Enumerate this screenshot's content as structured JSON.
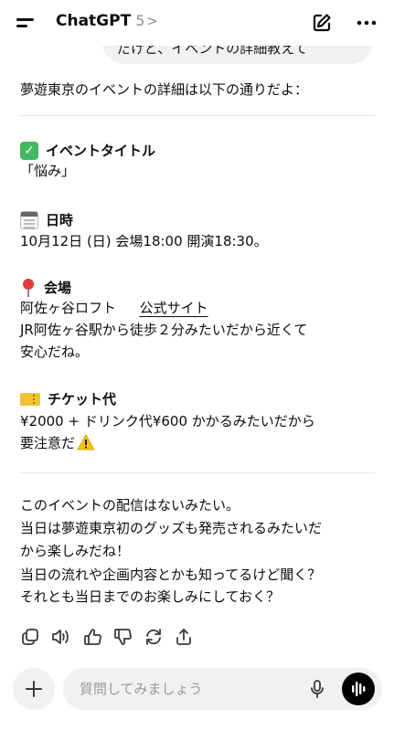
{
  "header": {
    "title": "ChatGPT",
    "version": "5",
    "chevron": ">"
  },
  "previous_user_message": "だけど、イベントの詳細教えて",
  "reply": {
    "intro": "夢遊東京のイベントの詳細は以下の通りだよ：",
    "sections": [
      {
        "icon": "check-icon",
        "heading": "イベントタイトル",
        "lines": [
          "「悩み」"
        ]
      },
      {
        "icon": "calendar-icon",
        "heading": "日時",
        "lines": [
          "10月12日 (日) 会場18:00 開演18:30。"
        ]
      },
      {
        "icon": "pin-icon",
        "heading": "会場",
        "venue": "阿佐ヶ谷ロフト",
        "link": "公式サイト",
        "lines": [
          "JR阿佐ヶ谷駅から徒歩２分みたいだから近くて",
          "安心だね。"
        ]
      },
      {
        "icon": "ticket-icon",
        "heading": "チケット代",
        "lines": [
          "¥2000 + ドリンク代¥600 かかるみたいだから",
          "要注意だ"
        ],
        "warning_icon": "warning-icon"
      }
    ],
    "closing": [
      "このイベントの配信はないみたい。",
      "当日は夢遊東京初のグッズも発売されるみたいだ",
      "から楽しみだね！",
      "当日の流れや企画内容とかも知ってるけど聞く？",
      "それとも当日までのお楽しみにしておく？"
    ]
  },
  "actions": [
    "copy-icon",
    "speaker-icon",
    "thumbs-up-icon",
    "thumbs-down-icon",
    "regenerate-icon",
    "share-icon"
  ],
  "composer": {
    "placeholder": "質問してみましょう"
  },
  "colors": {
    "background": "#ffffff",
    "text": "#0d0d0d",
    "muted": "#8e8e8e",
    "pill": "#f1f1f1",
    "check": "#41b85f",
    "warning": "#f4c20d"
  }
}
